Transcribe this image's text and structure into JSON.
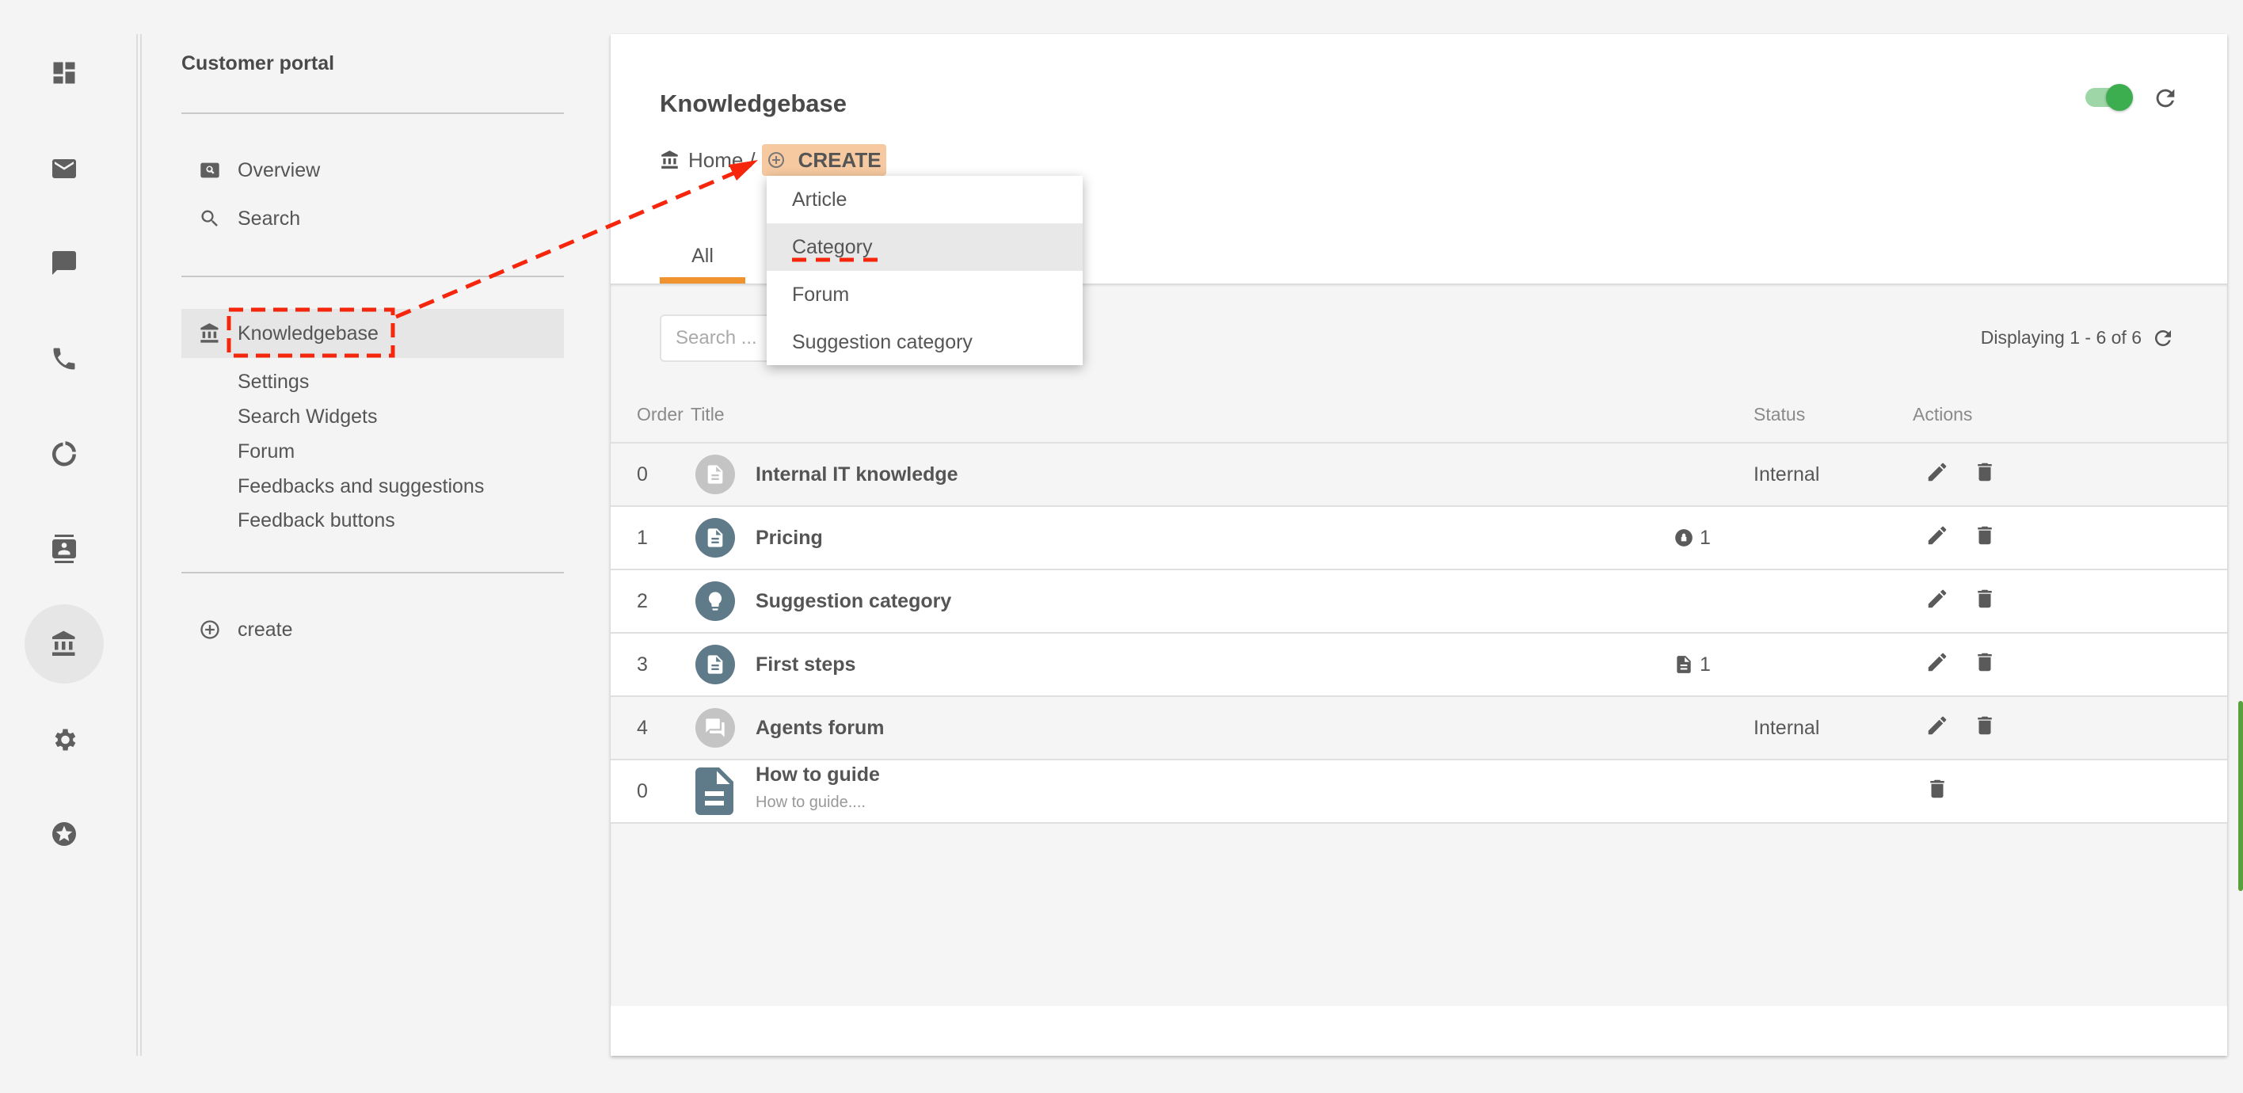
{
  "rail": {
    "items": [
      {
        "icon": "dashboard-icon"
      },
      {
        "icon": "mail-icon"
      },
      {
        "icon": "chat-icon"
      },
      {
        "icon": "phone-icon"
      },
      {
        "icon": "loading-circle-icon"
      },
      {
        "icon": "contacts-icon"
      },
      {
        "icon": "bank-icon",
        "active": true
      },
      {
        "icon": "gear-icon"
      },
      {
        "icon": "star-circle-icon"
      }
    ]
  },
  "sidebar": {
    "title": "Customer portal",
    "items": [
      {
        "label": "Overview",
        "icon": "overview-icon"
      },
      {
        "label": "Search",
        "icon": "search-icon"
      }
    ],
    "active": {
      "label": "Knowledgebase",
      "icon": "bank-icon"
    },
    "subitems": [
      "Settings",
      "Search Widgets",
      "Forum",
      "Feedbacks and suggestions",
      "Feedback buttons"
    ],
    "create": "create"
  },
  "header": {
    "title": "Knowledgebase",
    "breadcrumb": {
      "home": "Home",
      "separator": "/",
      "create": "CREATE"
    },
    "toggle_on": true,
    "accent": "#f0922e",
    "toggle_color": "#3cae50"
  },
  "dropdown": {
    "items": [
      "Article",
      "Category",
      "Forum",
      "Suggestion category"
    ],
    "highlighted": "Category"
  },
  "tabs": [
    {
      "label": "All",
      "active": true
    }
  ],
  "search": {
    "placeholder": "Search ..."
  },
  "pagination": {
    "text": "Displaying 1 - 6 of 6"
  },
  "table": {
    "columns": {
      "order": "Order",
      "title": "Title",
      "status": "Status",
      "actions": "Actions"
    },
    "rows": [
      {
        "order": "0",
        "title": "Internal IT knowledge",
        "status": "Internal",
        "count": "",
        "icon": "document-icon",
        "muted": true
      },
      {
        "order": "1",
        "title": "Pricing",
        "status": "",
        "count": "1",
        "count_icon": "lock-icon",
        "icon": "document-icon",
        "muted": false
      },
      {
        "order": "2",
        "title": "Suggestion category",
        "status": "",
        "count": "",
        "icon": "lightbulb-icon",
        "muted": false
      },
      {
        "order": "3",
        "title": "First steps",
        "status": "",
        "count": "1",
        "count_icon": "document-icon",
        "icon": "document-icon",
        "muted": false
      },
      {
        "order": "4",
        "title": "Agents forum",
        "status": "Internal",
        "count": "",
        "icon": "forum-icon",
        "muted": true
      },
      {
        "order": "0",
        "title": "How to guide",
        "subtitle": "How to guide....",
        "status": "",
        "count": "",
        "icon": "article-icon",
        "muted": false
      }
    ]
  }
}
